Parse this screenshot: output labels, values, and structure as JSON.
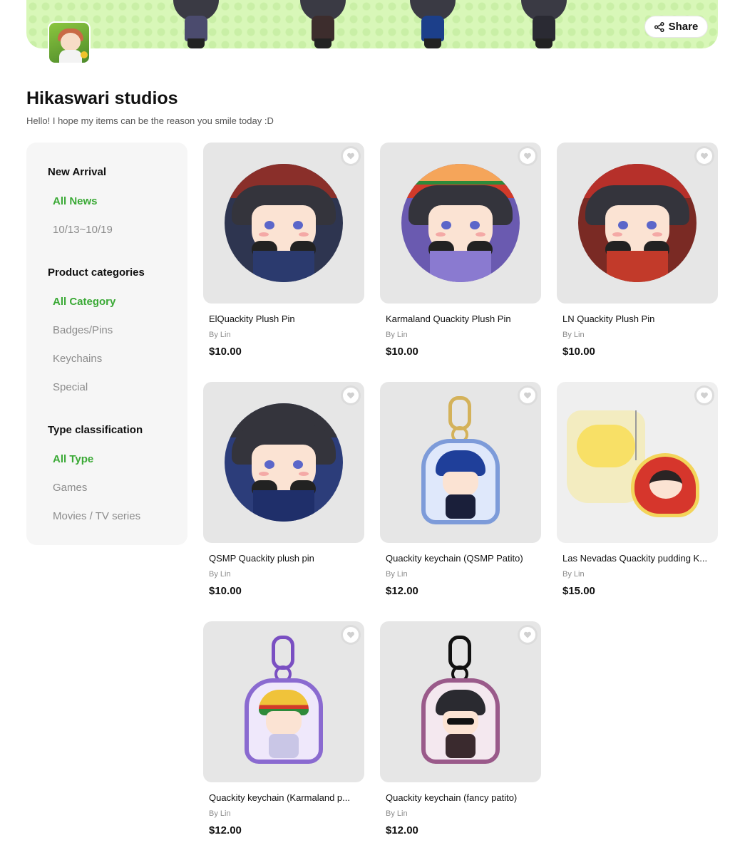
{
  "banner": {
    "share_label": "Share"
  },
  "shop": {
    "title": "Hikaswari studios",
    "description": "Hello! I hope my items can be the reason you smile today :D"
  },
  "sidebar": {
    "sections": [
      {
        "title": "New Arrival",
        "items": [
          {
            "label": "All News",
            "active": true
          },
          {
            "label": "10/13~10/19",
            "active": false
          }
        ]
      },
      {
        "title": "Product categories",
        "items": [
          {
            "label": "All Category",
            "active": true
          },
          {
            "label": "Badges/Pins",
            "active": false
          },
          {
            "label": "Keychains",
            "active": false
          },
          {
            "label": "Special",
            "active": false
          }
        ]
      },
      {
        "title": "Type classification",
        "items": [
          {
            "label": "All Type",
            "active": true
          },
          {
            "label": "Games",
            "active": false
          },
          {
            "label": "Movies / TV series",
            "active": false
          }
        ]
      }
    ]
  },
  "products": [
    {
      "name": "ElQuackity Plush Pin",
      "by": "By Lin",
      "price": "$10.00"
    },
    {
      "name": "Karmaland Quackity Plush Pin",
      "by": "By Lin",
      "price": "$10.00"
    },
    {
      "name": "LN Quackity Plush Pin",
      "by": "By Lin",
      "price": "$10.00"
    },
    {
      "name": "QSMP Quackity plush pin",
      "by": "By Lin",
      "price": "$10.00"
    },
    {
      "name": "Quackity keychain (QSMP Patito)",
      "by": "By Lin",
      "price": "$12.00"
    },
    {
      "name": "Las Nevadas Quackity pudding K...",
      "by": "By Lin",
      "price": "$15.00"
    },
    {
      "name": "Quackity keychain (Karmaland p...",
      "by": "By Lin",
      "price": "$12.00"
    },
    {
      "name": "Quackity keychain (fancy patito)",
      "by": "By Lin",
      "price": "$12.00"
    }
  ],
  "colors": {
    "accent": "#3aa935",
    "muted": "#8c8c8c",
    "banner": "#d8f7b8",
    "card": "#e6e6e6",
    "sidebar": "#f6f6f6"
  },
  "icons": {
    "share": "share-icon",
    "favorite": "heart-icon"
  }
}
